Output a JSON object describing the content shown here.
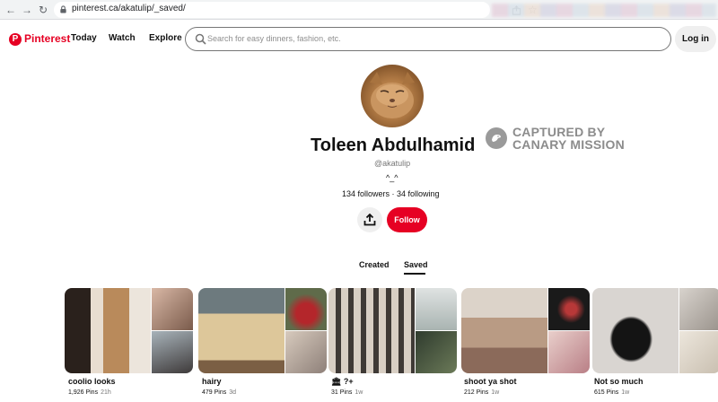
{
  "browser": {
    "url": "pinterest.ca/akatulip/_saved/"
  },
  "header": {
    "brand": "Pinterest",
    "nav": [
      "Today",
      "Watch",
      "Explore"
    ],
    "search_placeholder": "Search for easy dinners, fashion, etc.",
    "login_label": "Log in"
  },
  "profile": {
    "name": "Toleen Abdulhamid",
    "handle": "@akatulip",
    "bio": "^_^",
    "stats": "134 followers · 34 following",
    "follow_label": "Follow"
  },
  "watermark": {
    "line1": "CAPTURED BY",
    "line2": "CANARY MISSION"
  },
  "tabs": {
    "created": "Created",
    "saved": "Saved",
    "active": "saved"
  },
  "boards": [
    {
      "title": "coolio looks",
      "pins": "1,926 Pins",
      "age": "21h",
      "colors": [
        "#e9e2d8",
        "#9b8577",
        "#b6aaa3"
      ]
    },
    {
      "title": "hairy",
      "pins": "479 Pins",
      "age": "3d",
      "colors": [
        "#c9b48f",
        "#a83a33",
        "#cdbfb1"
      ]
    },
    {
      "title": "🏛 ?+",
      "pins": "31 Pins",
      "age": "1w",
      "colors": [
        "#b9a996",
        "#cfd3d2",
        "#3e4a3c"
      ]
    },
    {
      "title": "shoot ya shot",
      "pins": "212 Pins",
      "age": "1w",
      "colors": [
        "#c8b6a4",
        "#5b3b32",
        "#cfa8a4"
      ]
    },
    {
      "title": "Not so much",
      "pins": "615 Pins",
      "age": "1w",
      "colors": [
        "#dedbd8",
        "#d3cdc8",
        "#e6e0d6"
      ]
    }
  ],
  "theme": {
    "accent": "#e60023"
  }
}
